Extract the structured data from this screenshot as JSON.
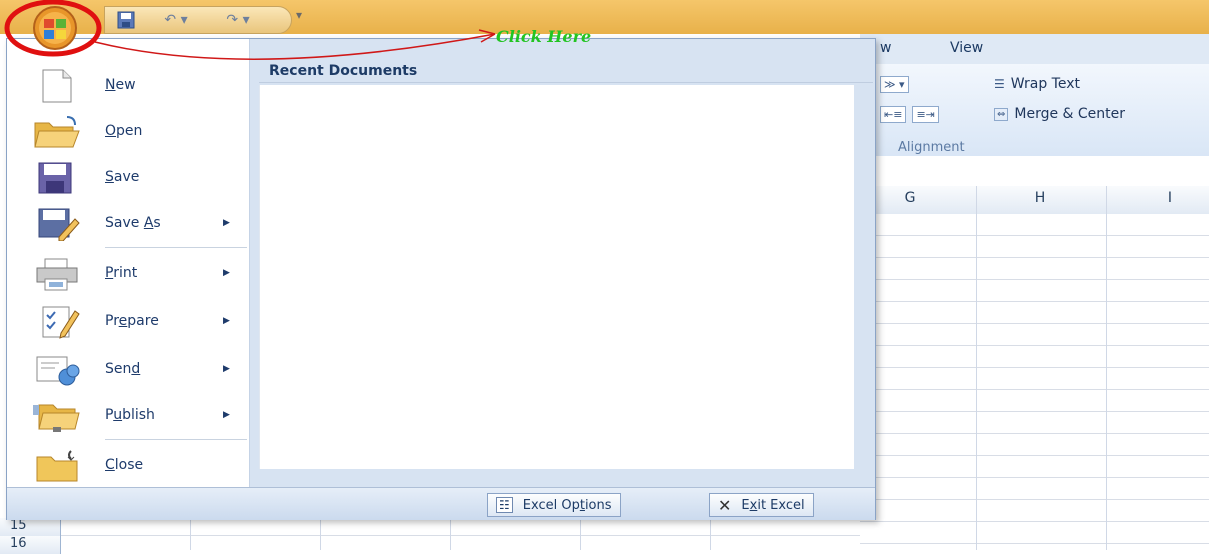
{
  "quick_access": {
    "undo_icon": "undo-icon",
    "redo_icon": "redo-icon",
    "save_icon": "save-icon",
    "customize": "▾"
  },
  "annotation": {
    "label": "Click Here"
  },
  "ribbon": {
    "tabs": [
      "w",
      "View"
    ],
    "wrap_text": "Wrap Text",
    "merge_center": "Merge & Center",
    "alignment_group": "Alignment"
  },
  "columns": [
    "G",
    "H",
    "I"
  ],
  "rows": [
    "15",
    "16"
  ],
  "office_menu": {
    "items": [
      {
        "label": "New",
        "ul": "N",
        "rest": "ew",
        "submenu": false
      },
      {
        "label": "Open",
        "ul": "O",
        "rest": "pen",
        "submenu": false
      },
      {
        "label": "Save",
        "ul": "S",
        "rest": "ave",
        "submenu": false
      },
      {
        "label": "Save As",
        "pre": "Save ",
        "ul": "A",
        "rest": "s",
        "submenu": true
      },
      {
        "label": "Print",
        "ul": "P",
        "rest": "rint",
        "submenu": true
      },
      {
        "label": "Prepare",
        "pre": "Pr",
        "ul": "e",
        "rest": "pare",
        "submenu": true
      },
      {
        "label": "Send",
        "pre": "Sen",
        "ul": "d",
        "rest": "",
        "submenu": true
      },
      {
        "label": "Publish",
        "pre": "P",
        "ul": "u",
        "rest": "blish",
        "submenu": true
      },
      {
        "label": "Close",
        "ul": "C",
        "rest": "lose",
        "submenu": false
      }
    ],
    "recent_title": "Recent Documents",
    "excel_options": "Excel Options",
    "exit_excel": "Exit Excel"
  },
  "colors": {
    "accent": "#1e3b6b",
    "annotation": "#22c422",
    "circle": "#e01010"
  }
}
